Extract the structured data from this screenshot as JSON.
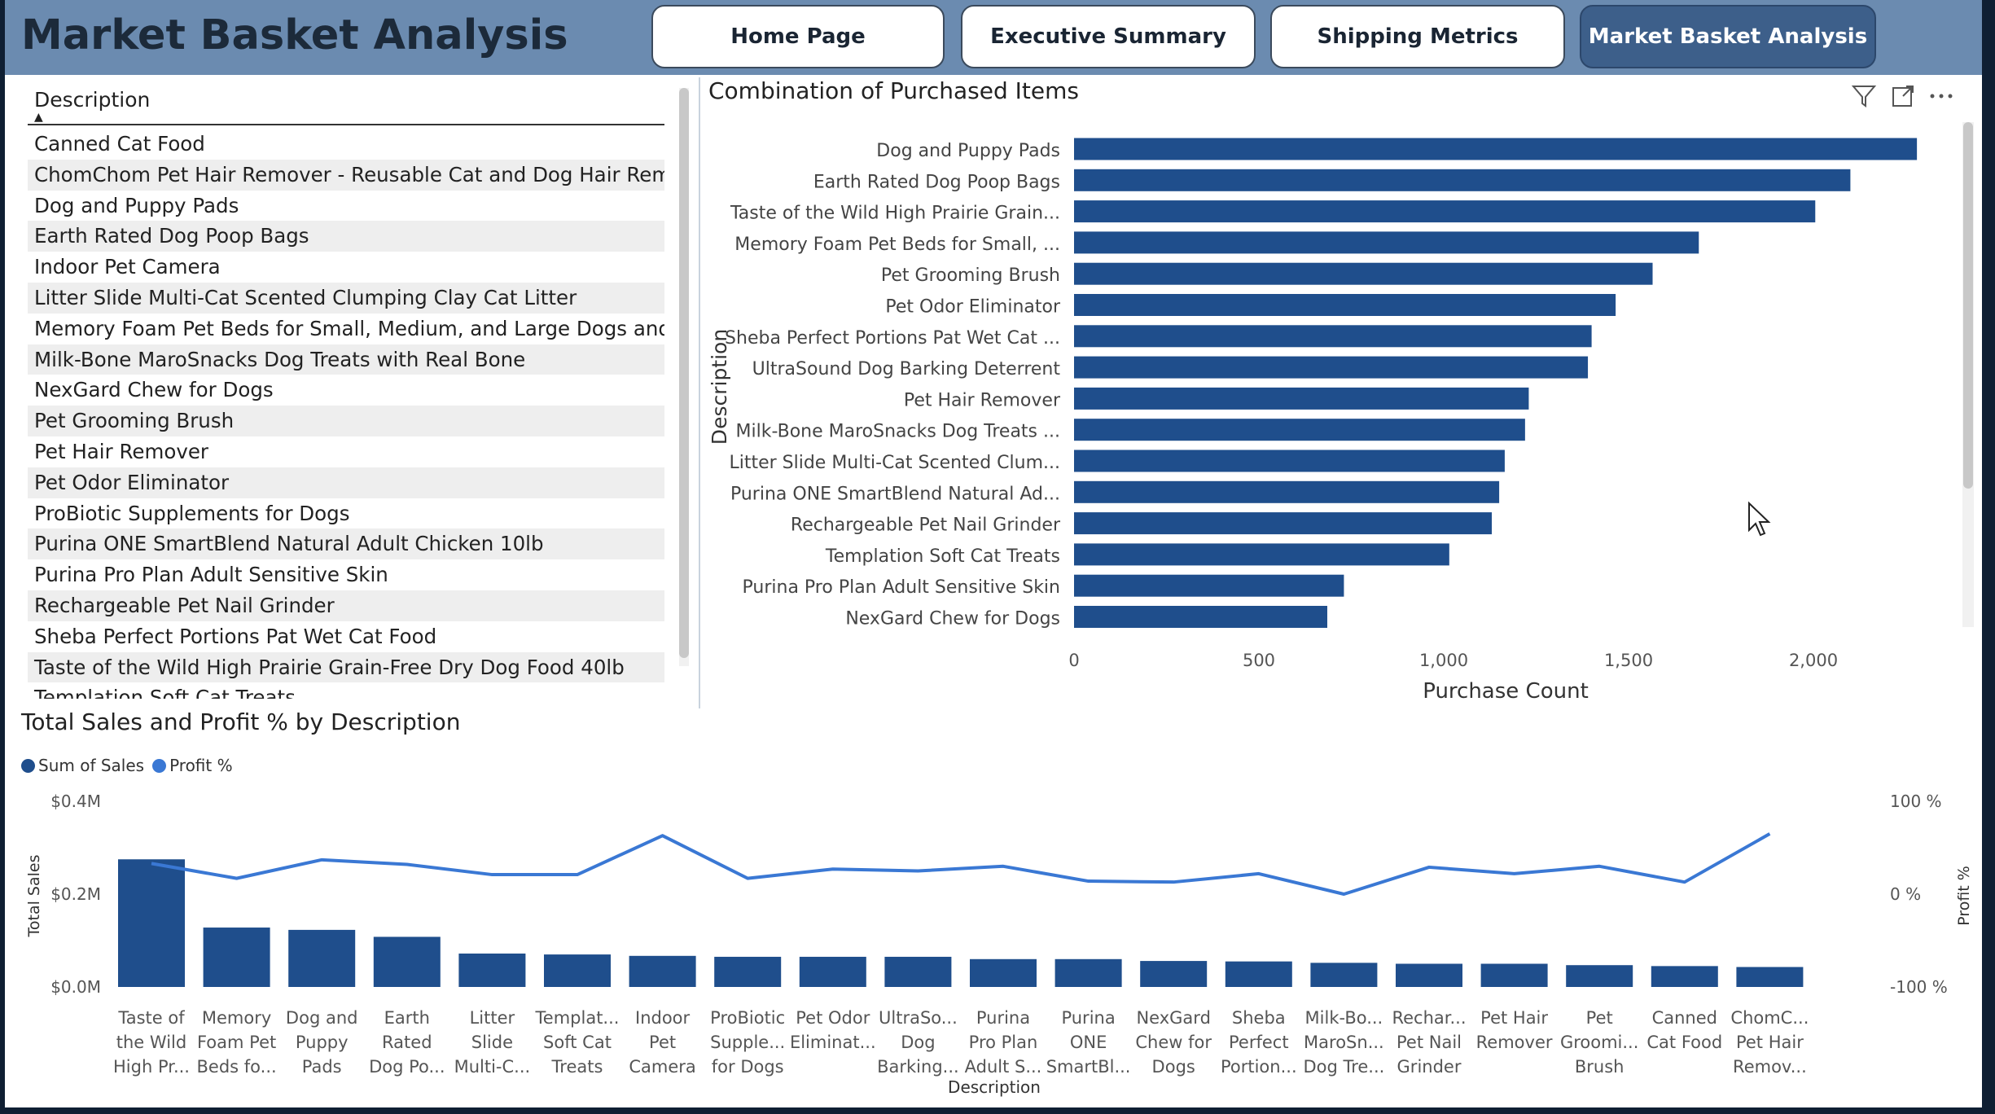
{
  "header": {
    "title": "Market Basket Analysis",
    "nav": [
      {
        "label": "Home Page",
        "active": false
      },
      {
        "label": "Executive Summary",
        "active": false
      },
      {
        "label": "Shipping Metrics",
        "active": false
      },
      {
        "label": "Market Basket Analysis",
        "active": true
      }
    ]
  },
  "slicer": {
    "header": "Description",
    "items": [
      "Canned Cat Food",
      "ChomChom Pet Hair Remover - Reusable Cat and Dog Hair Remover",
      "Dog and Puppy Pads",
      "Earth Rated Dog Poop Bags",
      "Indoor Pet Camera",
      "Litter Slide Multi-Cat Scented Clumping Clay Cat Litter",
      "Memory Foam Pet Beds for Small, Medium, and Large Dogs and Cats",
      "Milk-Bone MaroSnacks Dog Treats with Real Bone",
      "NexGard Chew for Dogs",
      "Pet Grooming Brush",
      "Pet Hair Remover",
      "Pet Odor Eliminator",
      "ProBiotic Supplements for Dogs",
      "Purina ONE SmartBlend Natural Adult Chicken 10lb",
      "Purina Pro Plan Adult Sensitive Skin",
      "Rechargeable Pet Nail Grinder",
      "Sheba Perfect Portions Pat Wet Cat Food",
      "Taste of the Wild High Prairie Grain-Free Dry Dog Food 40lb",
      "Templation Soft Cat Treats"
    ]
  },
  "icons": {
    "filter": "filter-icon",
    "focus": "focus-mode-icon",
    "more": "more-options-icon",
    "cursor": "mouse-pointer-icon"
  },
  "colors": {
    "bar": "#1f4e8c",
    "line": "#3a78d4",
    "header_bg": "#6b8bb0",
    "active_nav": "#3d5f8a"
  },
  "chart_data": [
    {
      "type": "bar",
      "orientation": "horizontal",
      "title": "Combination of Purchased Items",
      "xlabel": "Purchase Count",
      "ylabel": "Description",
      "xlim": [
        0,
        2400
      ],
      "xticks": [
        0,
        500,
        1000,
        1500,
        2000
      ],
      "xtick_labels": [
        "0",
        "500",
        "1,000",
        "1,500",
        "2,000"
      ],
      "grid": false,
      "categories": [
        "Dog and Puppy Pads",
        "Earth Rated Dog Poop Bags",
        "Taste of the Wild High Prairie Grain...",
        "Memory Foam Pet Beds for Small, ...",
        "Pet Grooming Brush",
        "Pet Odor Eliminator",
        "Sheba Perfect Portions Pat Wet Cat ...",
        "UltraSound Dog Barking Deterrent",
        "Pet Hair Remover",
        "Milk-Bone MaroSnacks Dog Treats ...",
        "Litter Slide Multi-Cat Scented Clum...",
        "Purina ONE SmartBlend Natural Ad...",
        "Rechargeable Pet Nail Grinder",
        "Templation Soft Cat Treats",
        "Purina Pro Plan Adult Sensitive Skin",
        "NexGard Chew for Dogs"
      ],
      "values": [
        2280,
        2100,
        2005,
        1690,
        1565,
        1465,
        1400,
        1390,
        1230,
        1220,
        1165,
        1150,
        1130,
        1015,
        730,
        685
      ]
    },
    {
      "type": "bar",
      "combo_with_line": true,
      "title": "Total Sales and Profit % by Description",
      "xlabel": "Description",
      "ylabel": "Total Sales",
      "ylabel_right": "Profit %",
      "ylim": [
        0,
        0.4
      ],
      "yticks": [
        "$0.0M",
        "$0.2M",
        "$0.4M"
      ],
      "ylim_right": [
        -100,
        100
      ],
      "yticks_right": [
        "-100 %",
        "0 %",
        "100 %"
      ],
      "legend_position": "top-left",
      "categories": [
        [
          "Taste of",
          "the Wild",
          "High Pr..."
        ],
        [
          "Memory",
          "Foam Pet",
          "Beds fo..."
        ],
        [
          "Dog and",
          "Puppy",
          "Pads"
        ],
        [
          "Earth",
          "Rated",
          "Dog Po..."
        ],
        [
          "Litter",
          "Slide",
          "Multi-C..."
        ],
        [
          "Templat...",
          "Soft Cat",
          "Treats"
        ],
        [
          "Indoor",
          "Pet",
          "Camera"
        ],
        [
          "ProBiotic",
          "Supple...",
          "for Dogs"
        ],
        [
          "Pet Odor",
          "Eliminat...",
          ""
        ],
        [
          "UltraSo...",
          "Dog",
          "Barking..."
        ],
        [
          "Purina",
          "Pro Plan",
          "Adult S..."
        ],
        [
          "Purina",
          "ONE",
          "SmartBl..."
        ],
        [
          "NexGard",
          "Chew for",
          "Dogs"
        ],
        [
          "Sheba",
          "Perfect",
          "Portion..."
        ],
        [
          "Milk-Bo...",
          "MaroSn...",
          "Dog Tre..."
        ],
        [
          "Rechar...",
          "Pet Nail",
          "Grinder"
        ],
        [
          "Pet Hair",
          "Remover",
          ""
        ],
        [
          "Pet",
          "Groomi...",
          "Brush"
        ],
        [
          "Canned",
          "Cat Food",
          ""
        ],
        [
          "ChomC...",
          "Pet Hair",
          "Remov..."
        ]
      ],
      "series": [
        {
          "name": "Sum of Sales",
          "axis": "left",
          "values": [
            0.275,
            0.128,
            0.123,
            0.108,
            0.072,
            0.07,
            0.067,
            0.065,
            0.065,
            0.065,
            0.06,
            0.06,
            0.056,
            0.055,
            0.052,
            0.05,
            0.05,
            0.047,
            0.045,
            0.043
          ]
        },
        {
          "name": "Profit %",
          "axis": "right",
          "values": [
            33,
            17,
            37,
            32,
            21,
            21,
            63,
            17,
            27,
            25,
            30,
            14,
            13,
            22,
            0,
            29,
            22,
            30,
            13,
            65
          ]
        }
      ]
    }
  ]
}
